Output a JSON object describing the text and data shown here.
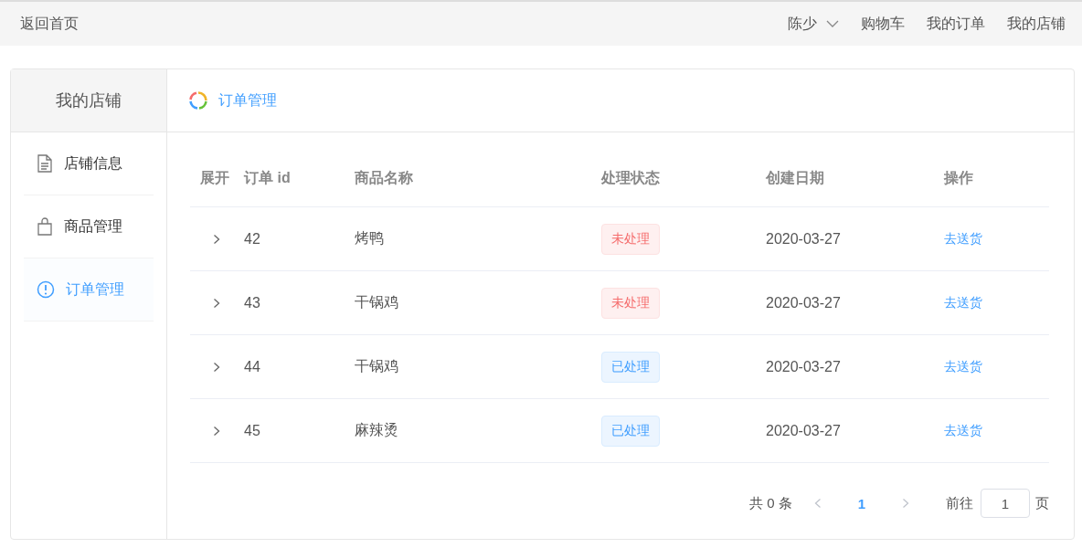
{
  "top_bar": {
    "home_link": "返回首页",
    "user": "陈少",
    "links": [
      "购物车",
      "我的订单",
      "我的店铺"
    ]
  },
  "sidebar": {
    "title": "我的店铺",
    "items": [
      {
        "label": "店铺信息",
        "kind": "document",
        "selected": false
      },
      {
        "label": "商品管理",
        "kind": "bag",
        "selected": false
      },
      {
        "label": "订单管理",
        "kind": "alert",
        "selected": true
      }
    ]
  },
  "panel": {
    "title": "订单管理"
  },
  "table": {
    "columns": [
      "展开",
      "订单 id",
      "商品名称",
      "处理状态",
      "创建日期",
      "操作"
    ],
    "rows": [
      {
        "id": "42",
        "product": "烤鸭",
        "status": "未处理",
        "kind": "pending",
        "date": "2020-03-27",
        "action": "去送货"
      },
      {
        "id": "43",
        "product": "干锅鸡",
        "status": "未处理",
        "kind": "pending",
        "date": "2020-03-27",
        "action": "去送货"
      },
      {
        "id": "44",
        "product": "干锅鸡",
        "status": "已处理",
        "kind": "done",
        "date": "2020-03-27",
        "action": "去送货"
      },
      {
        "id": "45",
        "product": "麻辣烫",
        "status": "已处理",
        "kind": "done",
        "date": "2020-03-27",
        "action": "去送货"
      }
    ]
  },
  "pagination": {
    "total": "共 0 条",
    "page": "1",
    "goto_label": "前往",
    "goto_value": "1",
    "goto_suffix": "页"
  }
}
